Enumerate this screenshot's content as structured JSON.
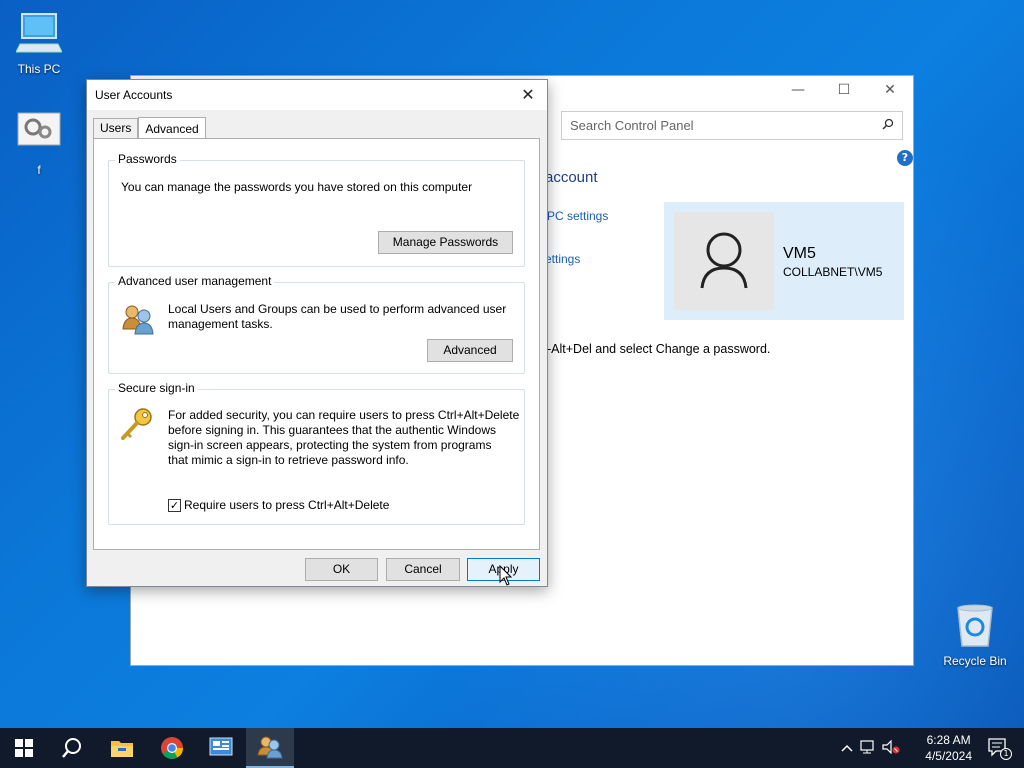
{
  "desktop": {
    "icons": [
      {
        "label": "This PC",
        "icon": "computer-icon"
      },
      {
        "label": "f",
        "icon": "settings-file-icon"
      },
      {
        "label": "Recycle Bin",
        "icon": "recycle-bin-icon"
      }
    ]
  },
  "control_panel": {
    "search_placeholder": "Search Control Panel",
    "heading_partial": "account",
    "link_pc_settings": "PC settings",
    "link_settings": "ettings",
    "body_text_partial": "-Alt+Del and select Change a password.",
    "user": {
      "name": "VM5",
      "domain": "COLLABNET\\VM5"
    },
    "help_label": "?"
  },
  "dialog": {
    "title": "User Accounts",
    "tabs": [
      {
        "label": "Users",
        "active": false
      },
      {
        "label": "Advanced",
        "active": true
      }
    ],
    "passwords": {
      "title": "Passwords",
      "text": "You can manage the passwords you have stored on this computer",
      "button": "Manage Passwords"
    },
    "advanced_mgmt": {
      "title": "Advanced user management",
      "text_line1": "Local Users and Groups can be used to perform advanced user",
      "text_line2": "management tasks.",
      "button": "Advanced"
    },
    "secure_signin": {
      "title": "Secure sign-in",
      "text_line1": "For added security, you can require users to press Ctrl+Alt+Delete",
      "text_line2": "before signing in. This guarantees that the authentic Windows",
      "text_line3": "sign-in screen appears, protecting the system from programs",
      "text_line4": "that mimic a sign-in to retrieve password info.",
      "checkbox_label": "Require users to press Ctrl+Alt+Delete",
      "checkbox_checked": true
    },
    "buttons": {
      "ok": "OK",
      "cancel": "Cancel",
      "apply": "Apply"
    }
  },
  "taskbar": {
    "clock_time": "6:28 AM",
    "clock_date": "4/5/2024",
    "notification_count": "1"
  }
}
